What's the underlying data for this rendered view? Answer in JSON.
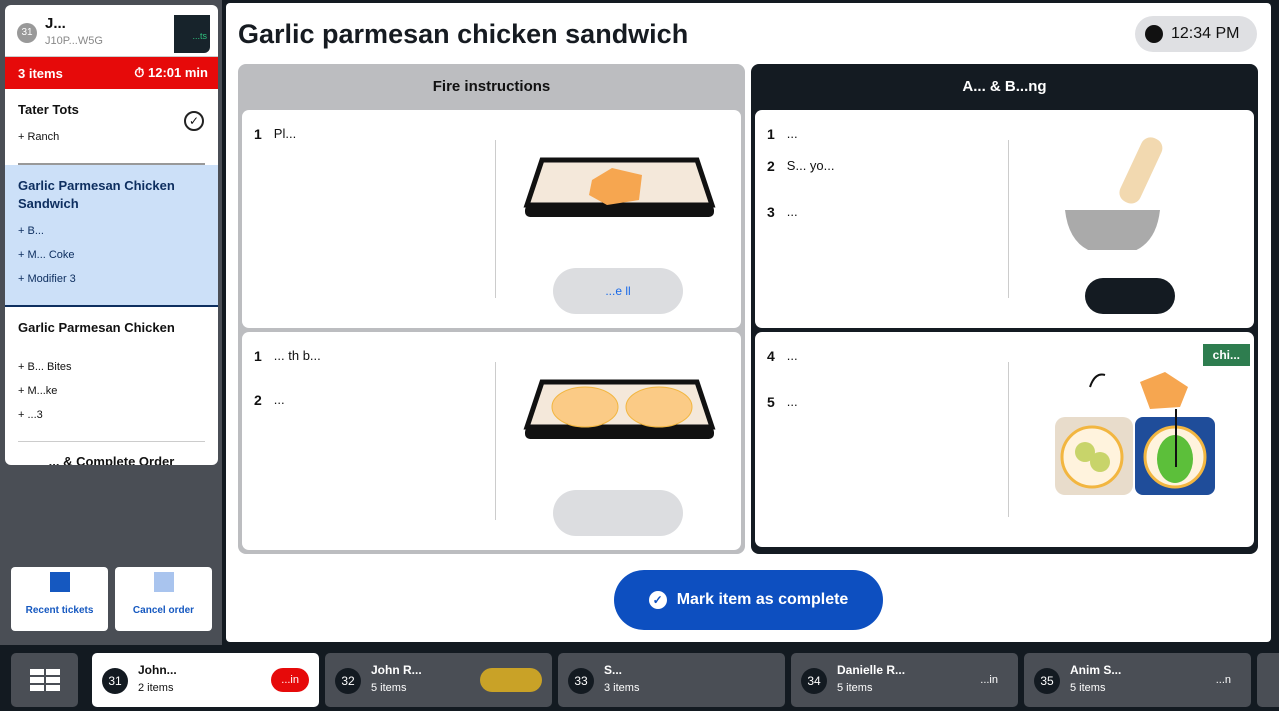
{
  "ticket": {
    "number": "31",
    "name": "J...",
    "code": "J10P...W5G",
    "button": "...ts",
    "items_count": "3 items",
    "timer": "12:01 min",
    "items": [
      {
        "name": "Tater Tots",
        "mods": [
          "+ Ranch"
        ],
        "done": true
      },
      {
        "name": "Garlic Parmesan Chicken Sandwich",
        "mods": [
          "+ B...",
          "+ M... Coke",
          "+ Modifier 3"
        ],
        "selected": true
      },
      {
        "name": "Garlic Parmesan Chicken",
        "mods": [
          "+ B... Bites",
          "+ M...ke",
          "+ ...3"
        ]
      }
    ],
    "complete_order": "... & Complete Order"
  },
  "left_buttons": {
    "recent": "Recent tickets",
    "cancel": "Cancel order"
  },
  "header": {
    "title": "Garlic parmesan chicken sandwich",
    "time": "12:34 PM"
  },
  "fire": {
    "title": "Fire instructions",
    "cards": [
      {
        "steps": [
          {
            "n": "1",
            "t": "Pl..."
          }
        ],
        "button": "...e ll"
      },
      {
        "steps": [
          {
            "n": "1",
            "t": "... th b..."
          },
          {
            "n": "2",
            "t": "..."
          }
        ],
        "button": ""
      }
    ]
  },
  "assembly": {
    "title": "A... & B...ng",
    "cards": [
      {
        "steps": [
          {
            "n": "1",
            "t": "..."
          },
          {
            "n": "2",
            "t": "S... yo..."
          },
          {
            "n": "3",
            "t": "..."
          }
        ],
        "button": ""
      },
      {
        "steps": [
          {
            "n": "4",
            "t": "..."
          },
          {
            "n": "5",
            "t": "..."
          }
        ],
        "tag": "chi..."
      }
    ]
  },
  "mark_complete": "Mark item as complete",
  "tabs": [
    {
      "n": "31",
      "name": "John...",
      "count": "2 items",
      "time": "...in",
      "active": true,
      "color": "#e60a0a"
    },
    {
      "n": "32",
      "name": "John R...",
      "count": "5 items",
      "time": "",
      "color": "#c9a227"
    },
    {
      "n": "33",
      "name": "S...",
      "count": "3 items",
      "time": ""
    },
    {
      "n": "34",
      "name": "Danielle R...",
      "count": "5 items",
      "time": "...in"
    },
    {
      "n": "35",
      "name": "Anim S...",
      "count": "5 items",
      "time": "...n"
    }
  ]
}
